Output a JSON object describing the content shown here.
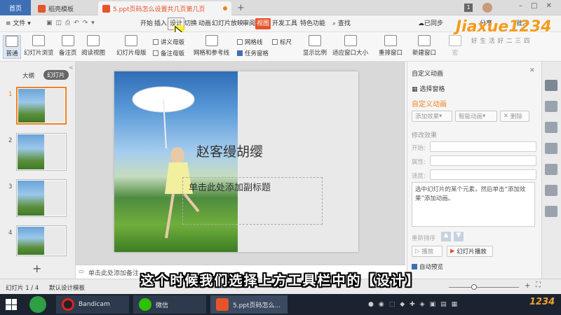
{
  "tabs": {
    "home": "首页",
    "template": "稻壳模板",
    "doc": "5.ppt页码怎么设置共几页第几页",
    "badge": "1"
  },
  "menu": {
    "file": "文件",
    "items": [
      "开始",
      "插入",
      "设计",
      "切换",
      "动画",
      "幻灯片放映",
      "审阅",
      "视图",
      "开发工具",
      "特色功能"
    ],
    "search": "查找",
    "sync": "已同步",
    "share": "分享",
    "comment": "批注"
  },
  "ribbon": {
    "normal": "普通",
    "sorter": "幻灯片浏览",
    "notes_page": "备注页",
    "reading": "阅读视图",
    "slide_master": "幻灯片母版",
    "handout_master": "讲义母版",
    "notes_master": "备注母版",
    "grid": "网格和参考线",
    "gridlines": "网格线",
    "ruler": "标尺",
    "taskpane": "任务窗格",
    "zoom": "显示比例",
    "fit": "适应窗口大小",
    "arrange": "重排窗口",
    "new_window": "新建窗口",
    "macro": "宏"
  },
  "left": {
    "outline": "大纲",
    "slides": "幻灯片",
    "numbers": [
      "1",
      "2",
      "3",
      "4"
    ],
    "add": "+"
  },
  "slide": {
    "title": "赵客缦胡缨",
    "subtitle": "单击此处添加副标题"
  },
  "notes": {
    "placeholder": "单击此处添加备注"
  },
  "right": {
    "header": "自定义动画",
    "select_pane": "选择窗格",
    "section": "自定义动画",
    "add_effect": "添加效果",
    "smart_anim": "智能动画",
    "delete": "删除",
    "modify": "修改效果",
    "start": "开始:",
    "prop": "属性:",
    "speed": "速度:",
    "info": "选中幻灯片的某个元素，然后单击“添加效果”添加动画。",
    "reorder": "重新排序",
    "play": "播放",
    "slideshow": "幻灯片播放",
    "autopreview": "自动预览"
  },
  "status": {
    "slide": "幻灯片 1 / 4",
    "theme": "默认设计模板"
  },
  "caption": "这个时候我们选择上方工具栏中的【设计】",
  "taskbar": {
    "bandicam": "Bandicam",
    "wechat": "微信",
    "ppt": "5.ppt页码怎么..."
  },
  "watermark": {
    "logo": "Jiaxue1234",
    "motto": "好生活好二三四",
    "corner": "1234"
  },
  "colors": {
    "accent": "#e8532a",
    "selection": "#f0821e"
  }
}
